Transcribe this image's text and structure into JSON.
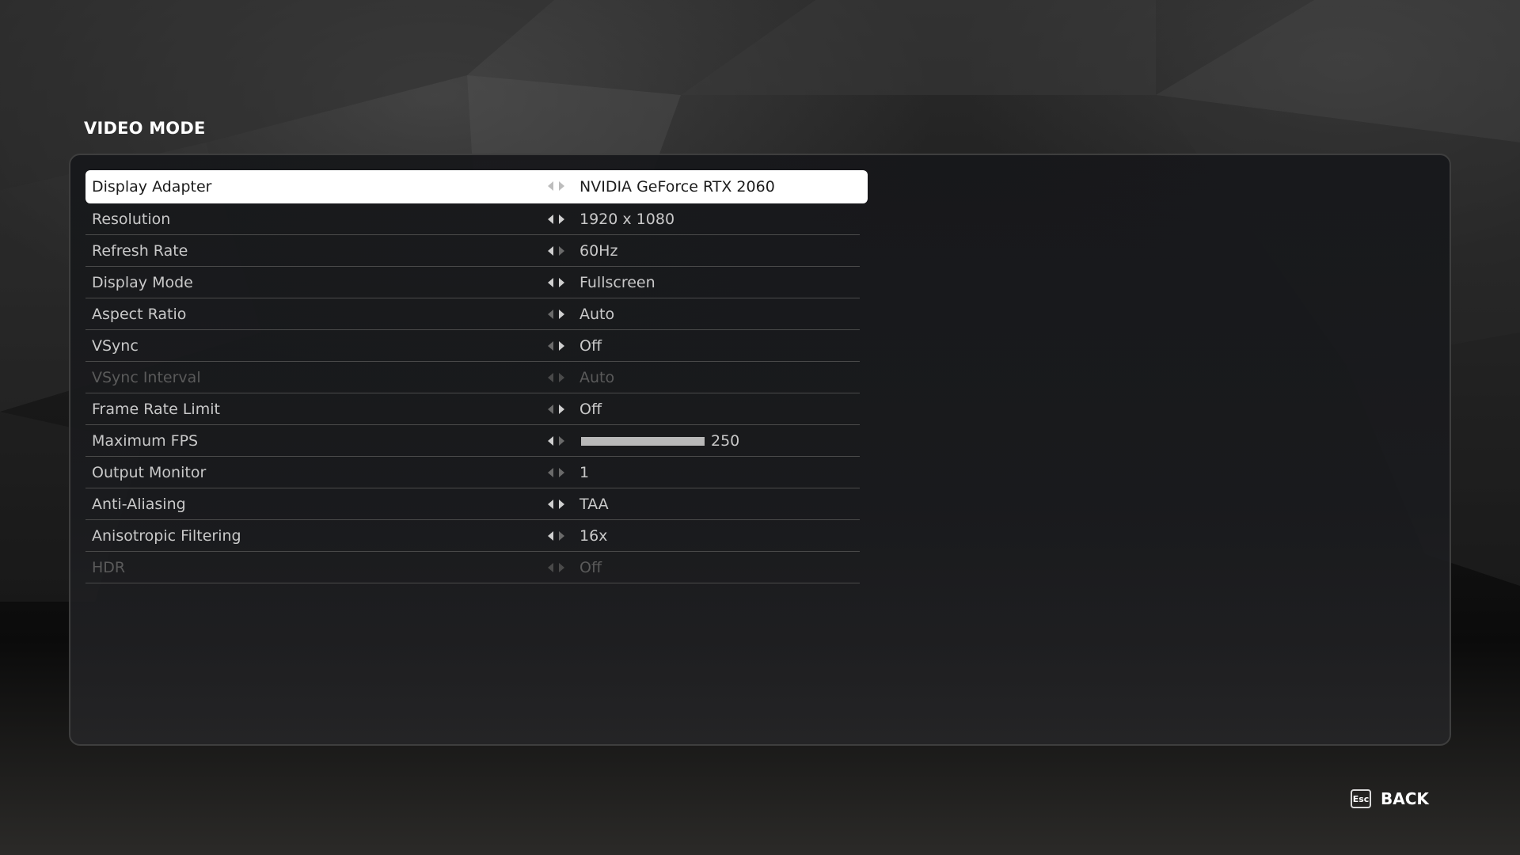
{
  "page": {
    "title": "VIDEO MODE"
  },
  "settings": [
    {
      "label": "Display Adapter",
      "value": "NVIDIA GeForce RTX 2060",
      "state": "selected",
      "left_active": false,
      "right_active": false
    },
    {
      "label": "Resolution",
      "value": "1920 x 1080",
      "state": "normal",
      "left_active": true,
      "right_active": true
    },
    {
      "label": "Refresh Rate",
      "value": "60Hz",
      "state": "normal",
      "left_active": true,
      "right_active": false
    },
    {
      "label": "Display Mode",
      "value": "Fullscreen",
      "state": "normal",
      "left_active": true,
      "right_active": true
    },
    {
      "label": "Aspect Ratio",
      "value": "Auto",
      "state": "normal",
      "left_active": false,
      "right_active": true
    },
    {
      "label": "VSync",
      "value": "Off",
      "state": "normal",
      "left_active": false,
      "right_active": true
    },
    {
      "label": "VSync Interval",
      "value": "Auto",
      "state": "disabled",
      "left_active": false,
      "right_active": false
    },
    {
      "label": "Frame Rate Limit",
      "value": "Off",
      "state": "normal",
      "left_active": false,
      "right_active": true
    },
    {
      "label": "Maximum FPS",
      "value": "250",
      "state": "normal",
      "left_active": true,
      "right_active": false,
      "slider_fraction": 1.0
    },
    {
      "label": "Output Monitor",
      "value": "1",
      "state": "normal",
      "left_active": false,
      "right_active": false
    },
    {
      "label": "Anti-Aliasing",
      "value": "TAA",
      "state": "normal",
      "left_active": true,
      "right_active": true
    },
    {
      "label": "Anisotropic Filtering",
      "value": "16x",
      "state": "normal",
      "left_active": true,
      "right_active": false
    },
    {
      "label": "HDR",
      "value": "Off",
      "state": "disabled",
      "left_active": false,
      "right_active": false
    }
  ],
  "footer": {
    "back_key": "Esc",
    "back_label": "BACK"
  },
  "icons": {
    "left_arrow": "arrow-left-icon",
    "right_arrow": "arrow-right-icon",
    "esc_key": "esc-key-icon"
  },
  "colors": {
    "selected_row_bg": "#ffffff",
    "text_normal": "#c9c9c9",
    "text_disabled": "#5a5a5a",
    "title": "#ffffff"
  }
}
